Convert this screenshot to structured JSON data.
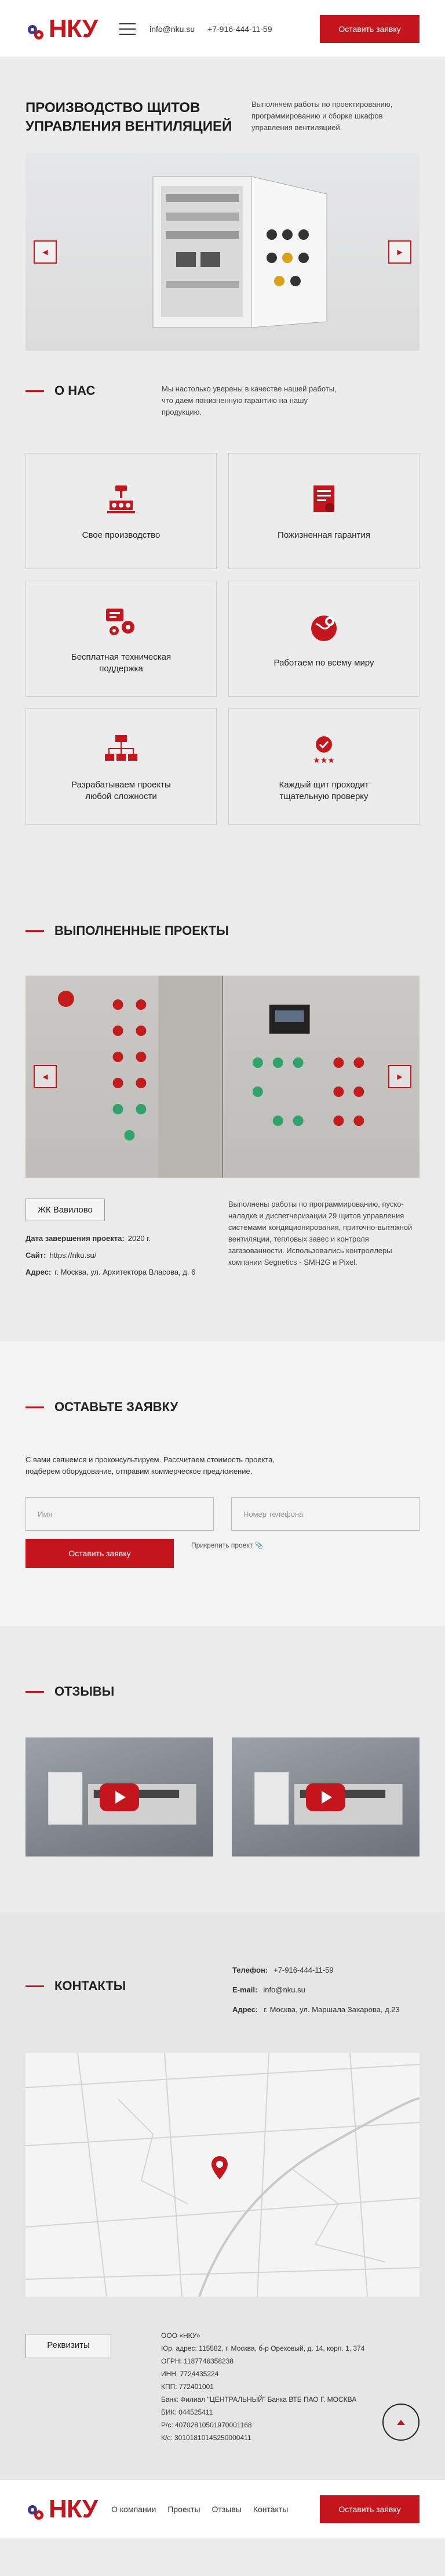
{
  "header": {
    "logo": "НКУ",
    "email": "info@nku.su",
    "phone": "+7-916-444-11-59",
    "cta": "Оставить заявку"
  },
  "hero": {
    "title": "Производство щитов управления вентиляцией",
    "text": "Выполняем работы по проектированию, программированию и сборке шкафов управления вентиляцией."
  },
  "about": {
    "title": "О нас",
    "text": "Мы настолько уверены в качестве нашей работы, что даем пожизненную гарантию на нашу продукцию.",
    "cards": [
      {
        "label": "Свое производство",
        "icon": "factory-icon"
      },
      {
        "label": "Пожизненная гарантия",
        "icon": "certificate-icon"
      },
      {
        "label": "Бесплатная техническая поддержка",
        "icon": "support-icon"
      },
      {
        "label": "Работаем по всему миру",
        "icon": "globe-pin-icon"
      },
      {
        "label": "Разрабатываем проекты любой сложности",
        "icon": "hierarchy-icon"
      },
      {
        "label": "Каждый щит проходит тщательную проверку",
        "icon": "quality-badge-icon"
      }
    ]
  },
  "projects": {
    "title": "Выполненные проекты",
    "name": "ЖК Вавилово",
    "date_label": "Дата завершения проекта:",
    "date": "2020 г.",
    "site_label": "Сайт:",
    "site": "https://nku.su/",
    "addr_label": "Адрес:",
    "addr": "г. Москва, ул. Архитектора Власова, д. 6",
    "desc": "Выполнены работы по программированию, пуско-наладке и диспетчеризации 29 щитов управления системами кондиционирования, приточно-вытяжной вентиляции, тепловых завес и контроля загазованности. Использовались контроллеры компании Segnetics - SMH2G и Pixel."
  },
  "request": {
    "title": "Оставьте заявку",
    "desc": "С вами свяжемся и проконсультируем. Рассчитаем стоимость проекта, подберем оборудование, отправим коммерческое предложение.",
    "name_ph": "Имя",
    "phone_ph": "Номер телефона",
    "submit": "Оставить заявку",
    "attach": "Прикрепить проект"
  },
  "reviews": {
    "title": "Отзывы"
  },
  "contacts": {
    "title": "Контакты",
    "phone_label": "Телефон:",
    "phone": "+7-916-444-11-59",
    "email_label": "E-mail:",
    "email": "info@nku.su",
    "addr_label": "Адрес:",
    "addr": "г. Москва, ул. Маршала Захарова, д.23",
    "req_button": "Реквизиты",
    "requisites": [
      "ООО «НКУ»",
      "Юр. адрес: 115582, г. Москва, б-р Ореховый, д. 14, корп. 1, 374",
      "ОГРН: 1187746358238",
      "ИНН: 7724435224",
      "КПП: 772401001",
      "Банк: Филиал \"ЦЕНТРАЛЬНЫЙ\" Банка ВТБ ПАО Г. МОСКВА",
      "БИК: 044525411",
      "Р/с: 40702810501970001168",
      "К/с: 30101810145250000411"
    ]
  },
  "footer": {
    "nav": [
      "О компании",
      "Проекты",
      "Отзывы",
      "Контакты"
    ],
    "cta": "Оставить заявку"
  },
  "colors": {
    "accent": "#c4161c",
    "background": "#ececec"
  }
}
